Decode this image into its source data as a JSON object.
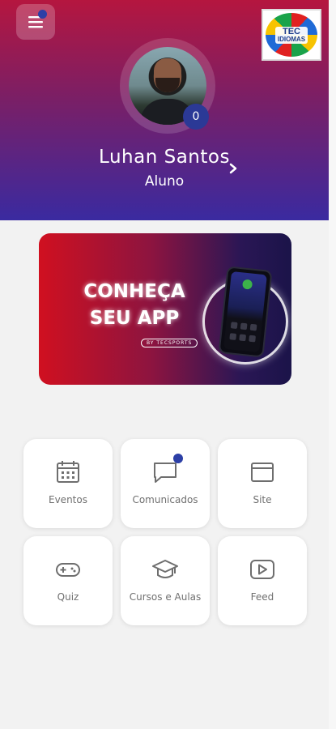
{
  "header": {
    "logo": {
      "line1": "TEC",
      "line2": "IDIOMAS"
    },
    "user": {
      "name": "Luhan Santos",
      "role": "Aluno",
      "badge_count": "0"
    }
  },
  "banner": {
    "line1": "CONHEÇA",
    "line2": "SEU APP",
    "by": "BY TECSPORTS"
  },
  "tiles": [
    {
      "label": "Eventos",
      "icon": "calendar-icon"
    },
    {
      "label": "Comunicados",
      "icon": "chat-message-icon",
      "notification": true
    },
    {
      "label": "Site",
      "icon": "browser-window-icon"
    },
    {
      "label": "Quiz",
      "icon": "gamepad-icon"
    },
    {
      "label": "Cursos e Aulas",
      "icon": "graduation-cap-icon"
    },
    {
      "label": "Feed",
      "icon": "video-play-icon"
    }
  ],
  "colors": {
    "header_top": "#b5163f",
    "header_bottom": "#3a2aa0",
    "badge": "#2b3996",
    "icon_gray": "#6e6e6e"
  }
}
